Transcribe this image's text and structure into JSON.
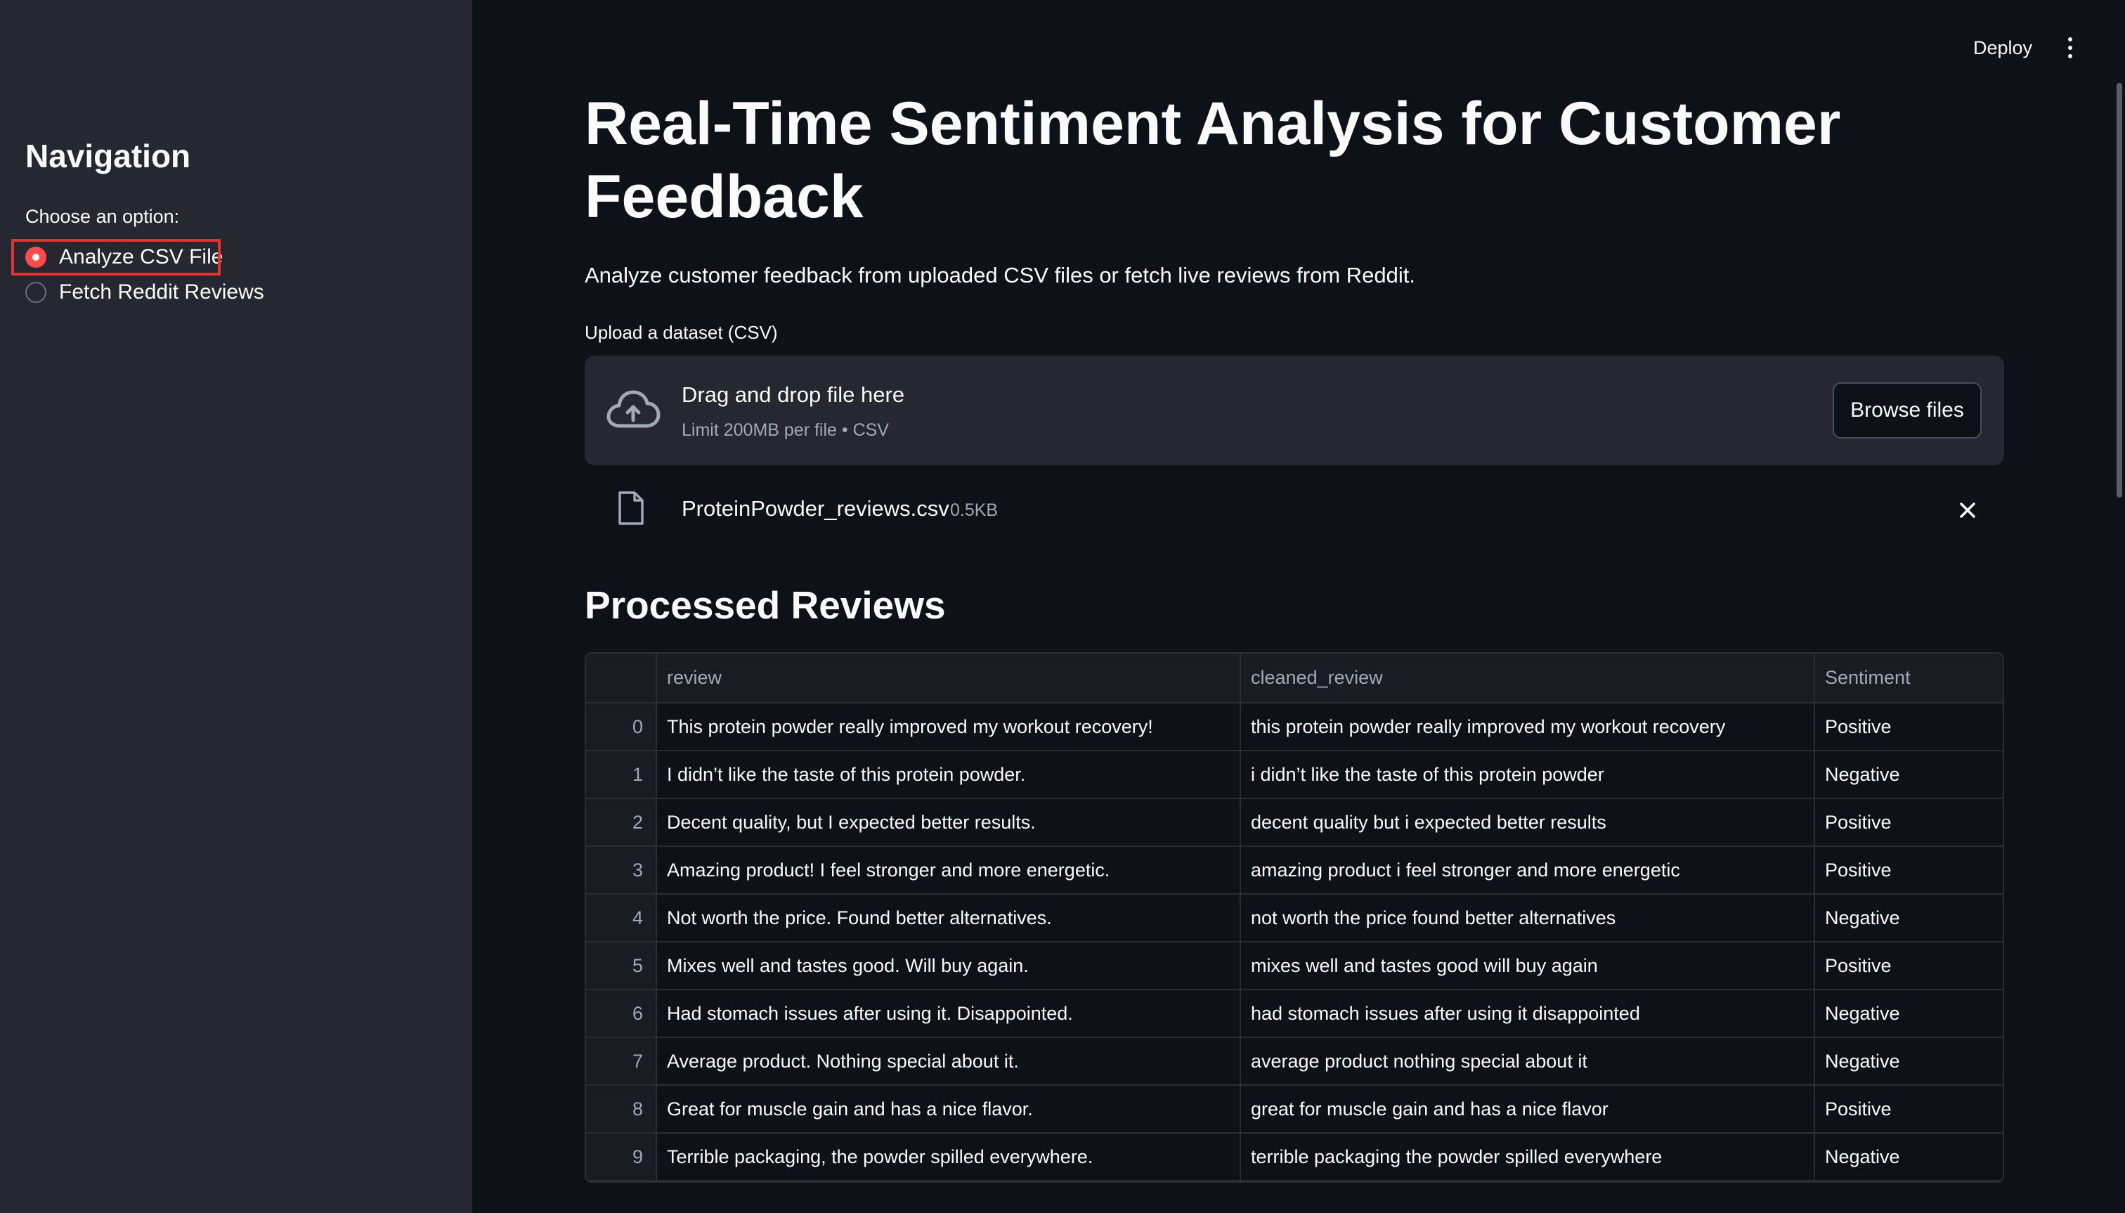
{
  "sidebar": {
    "title": "Navigation",
    "choose_label": "Choose an option:",
    "options": [
      {
        "label": "Analyze CSV File",
        "selected": true
      },
      {
        "label": "Fetch Reddit Reviews",
        "selected": false
      }
    ]
  },
  "header": {
    "deploy_label": "Deploy",
    "menu_icon": "kebab-menu-icon"
  },
  "main": {
    "title": "Real-Time Sentiment Analysis for Customer Feedback",
    "subtitle": "Analyze customer feedback from uploaded CSV files or fetch live reviews from Reddit.",
    "upload": {
      "label": "Upload a dataset (CSV)",
      "drop_title": "Drag and drop file here",
      "drop_limit": "Limit 200MB per file • CSV",
      "browse_label": "Browse files",
      "icon": "cloud-upload-icon"
    },
    "uploaded_file": {
      "name": "ProteinPowder_reviews.csv",
      "size": "0.5KB",
      "icon": "file-icon"
    },
    "section_title": "Processed Reviews",
    "table": {
      "columns": [
        "",
        "review",
        "cleaned_review",
        "Sentiment"
      ],
      "rows": [
        {
          "index": "0",
          "review": "This protein powder really improved my workout recovery!",
          "cleaned_review": "this protein powder really improved my workout recovery",
          "sentiment": "Positive"
        },
        {
          "index": "1",
          "review": "I didn’t like the taste of this protein powder.",
          "cleaned_review": "i didn’t like the taste of this protein powder",
          "sentiment": "Negative"
        },
        {
          "index": "2",
          "review": "Decent quality, but I expected better results.",
          "cleaned_review": "decent quality but i expected better results",
          "sentiment": "Positive"
        },
        {
          "index": "3",
          "review": "Amazing product! I feel stronger and more energetic.",
          "cleaned_review": "amazing product i feel stronger and more energetic",
          "sentiment": "Positive"
        },
        {
          "index": "4",
          "review": "Not worth the price. Found better alternatives.",
          "cleaned_review": "not worth the price found better alternatives",
          "sentiment": "Negative"
        },
        {
          "index": "5",
          "review": "Mixes well and tastes good. Will buy again.",
          "cleaned_review": "mixes well and tastes good will buy again",
          "sentiment": "Positive"
        },
        {
          "index": "6",
          "review": "Had stomach issues after using it. Disappointed.",
          "cleaned_review": "had stomach issues after using it disappointed",
          "sentiment": "Negative"
        },
        {
          "index": "7",
          "review": "Average product. Nothing special about it.",
          "cleaned_review": "average product nothing special about it",
          "sentiment": "Negative"
        },
        {
          "index": "8",
          "review": "Great for muscle gain and has a nice flavor.",
          "cleaned_review": "great for muscle gain and has a nice flavor",
          "sentiment": "Positive"
        },
        {
          "index": "9",
          "review": "Terrible packaging, the powder spilled everywhere.",
          "cleaned_review": "terrible packaging the powder spilled everywhere",
          "sentiment": "Negative"
        }
      ]
    }
  },
  "colors": {
    "accent": "#ff4b4b",
    "background": "#0e1117",
    "sidebar": "#262730",
    "highlight_box": "#e3342f"
  }
}
